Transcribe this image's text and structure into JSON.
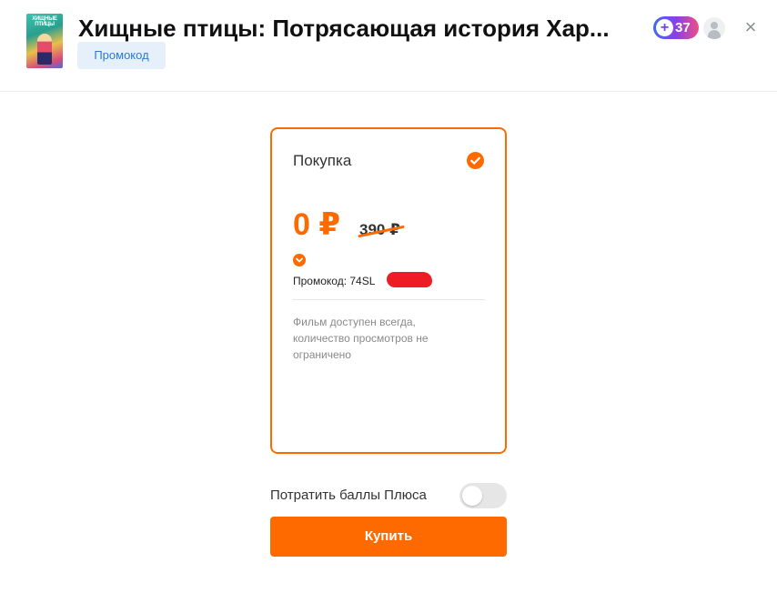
{
  "header": {
    "title": "Хищные птицы: Потрясающая история Хар...",
    "promo_tag": "Промокод",
    "poster_text": "ХИЩНЫЕ ПТИЦЫ",
    "plus_badge_count": "37",
    "plus_icon": "+"
  },
  "icons": {
    "close": "×"
  },
  "card": {
    "title": "Покупка",
    "price": "0 ₽",
    "old_price": "390 ₽",
    "promo_code": "Промокод: 74SL",
    "description": "Фильм доступен всегда, количество просмотров не ограничено"
  },
  "plus_points": {
    "label": "Потратить баллы Плюса",
    "enabled": false
  },
  "buy_button": {
    "label": "Купить"
  },
  "colors": {
    "accent": "#ff6a00",
    "promo_tag_bg": "#e6f0fb",
    "promo_tag_text": "#2d7ad3",
    "redaction": "#ee1c24"
  }
}
